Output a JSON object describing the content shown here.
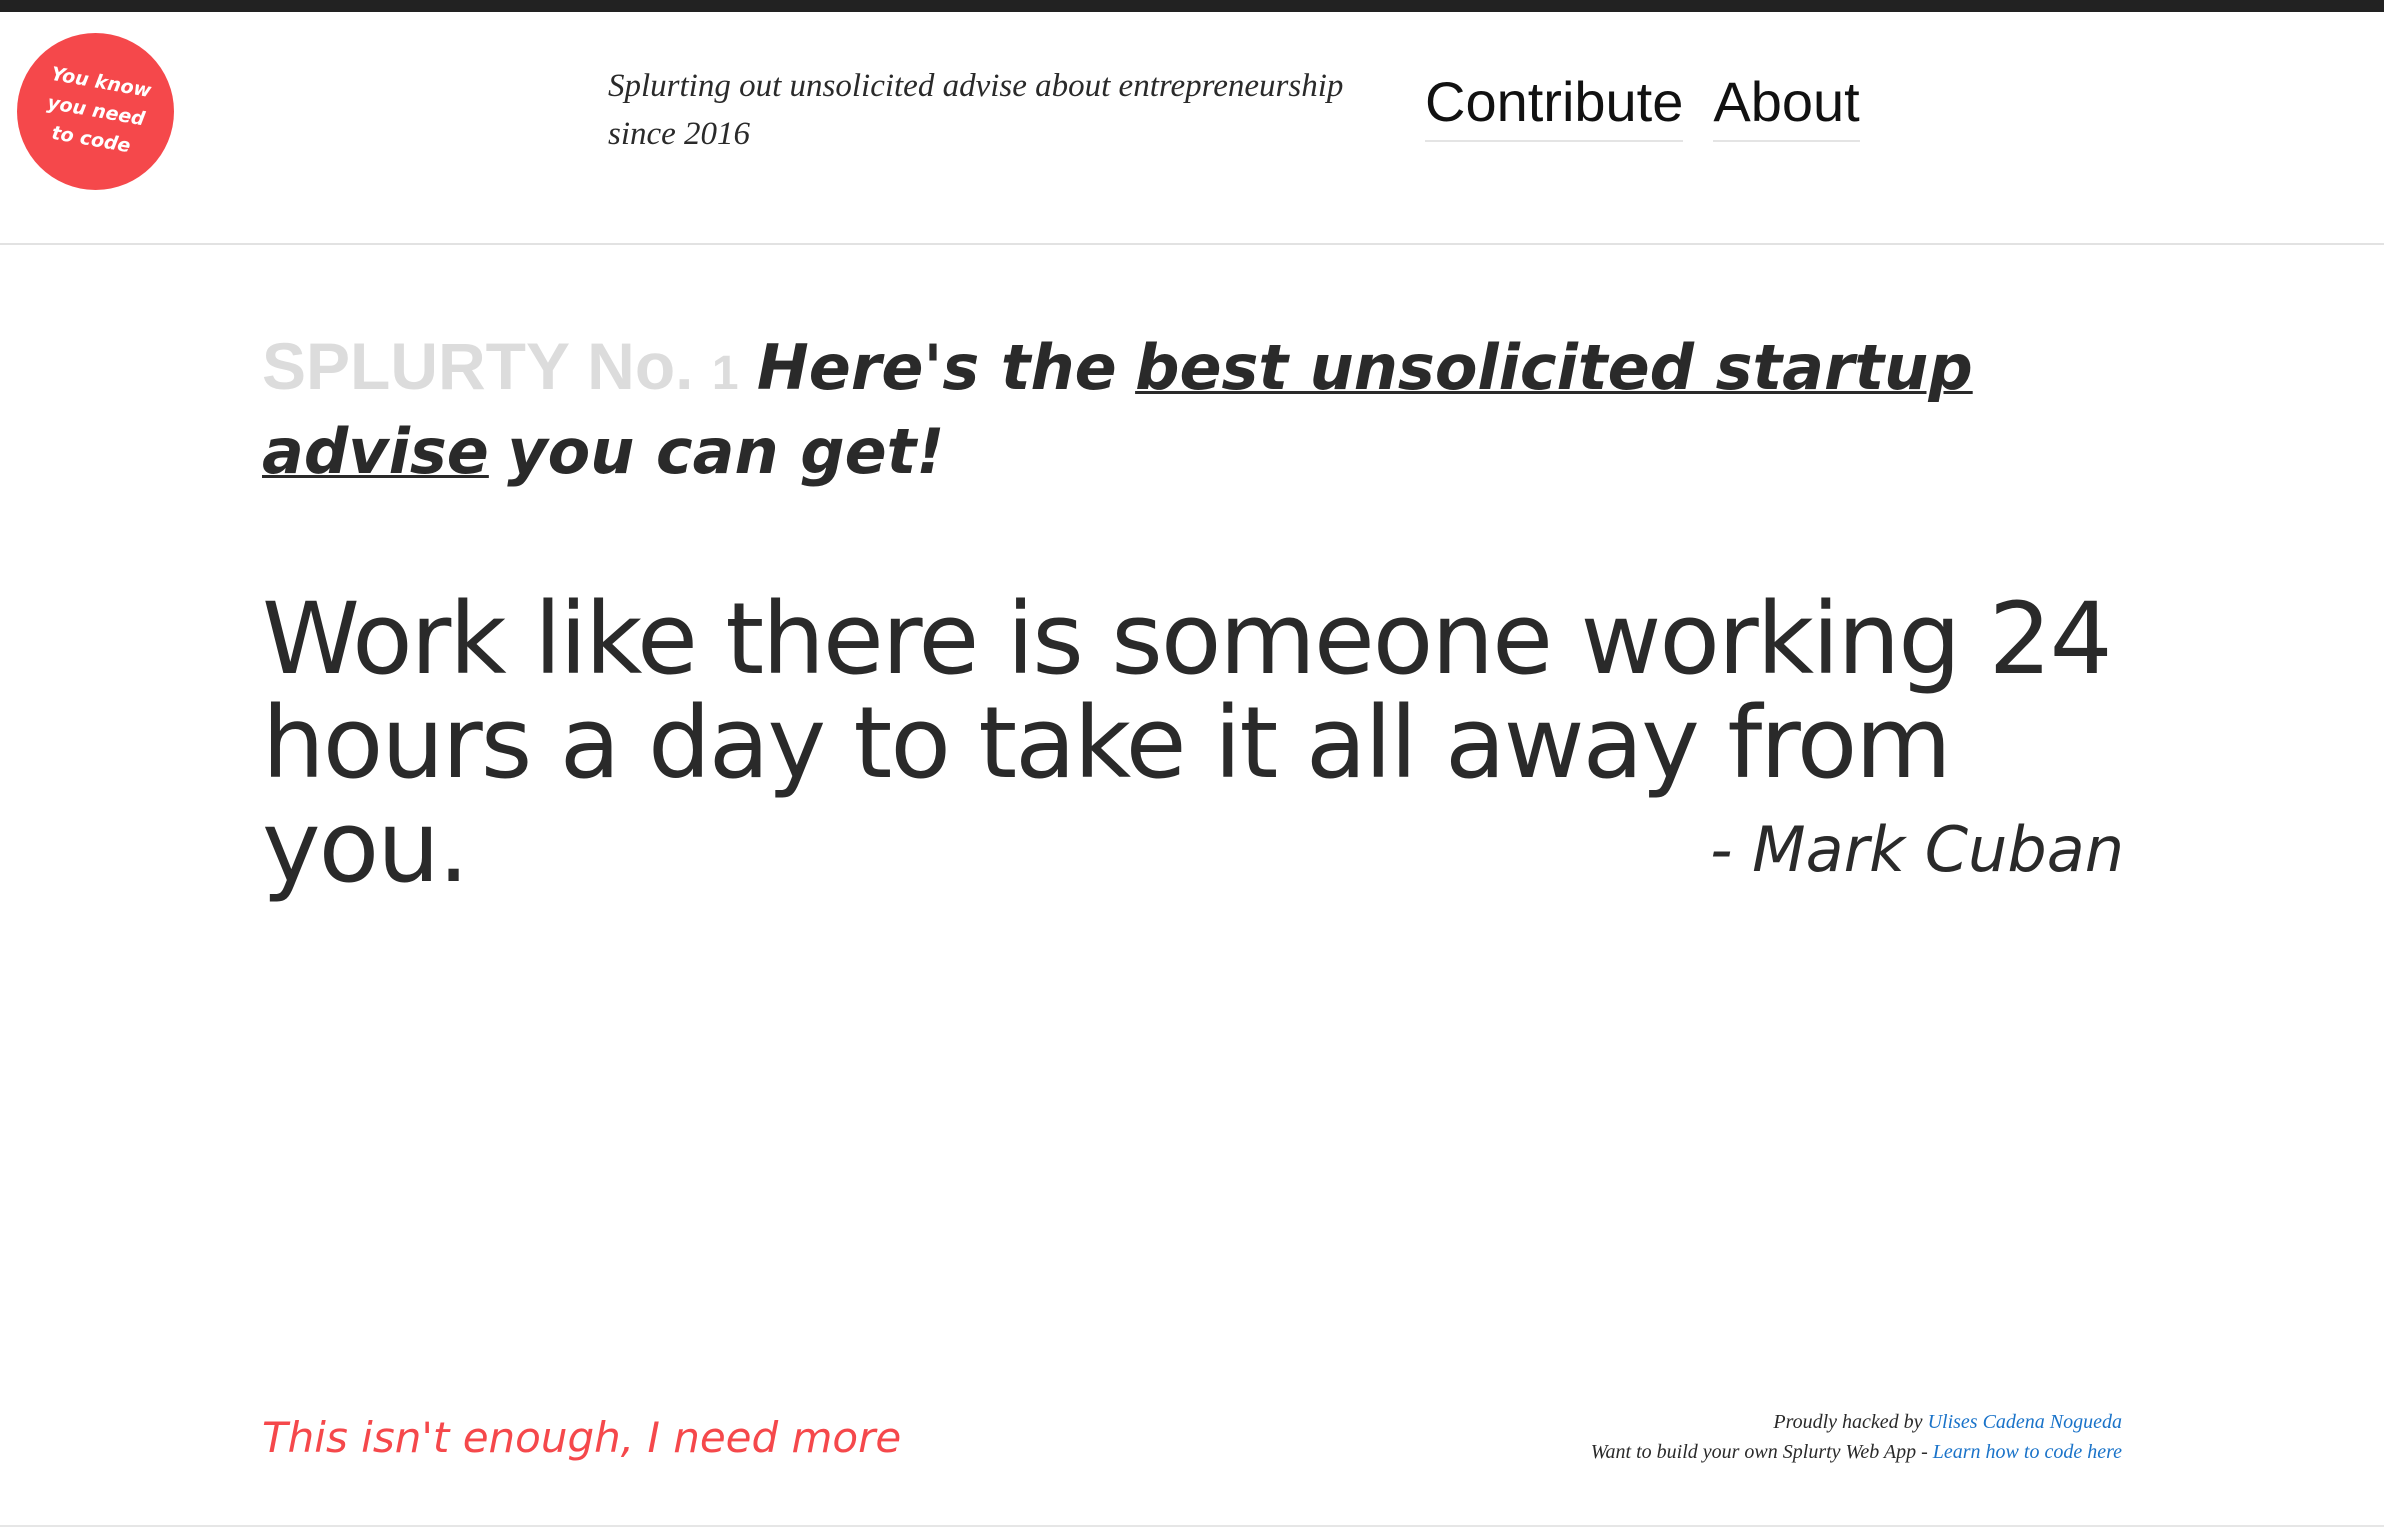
{
  "badge": {
    "text": "You know you need to code",
    "color": "#f5484b"
  },
  "header": {
    "tagline": "Splurting out unsolicited advise about entrepreneurship since 2016",
    "nav": {
      "contribute": "Contribute",
      "about": "About"
    }
  },
  "main": {
    "splurty_label": "SPLURTY No.",
    "splurty_number": "1",
    "headline_before": "Here's the",
    "headline_link": "best unsolicited startup advise",
    "headline_after": "you can get!",
    "quote": "Work like there is someone working 24 hours a day to take it all away from you.",
    "author": "- Mark Cuban"
  },
  "footer": {
    "more_link": "This isn't enough, I need more",
    "credit_prefix": "Proudly hacked by",
    "credit_name": "Ulises Cadena Nogueda",
    "build_prefix": "Want to build your own Splurty Web App -",
    "build_link": "Learn how to code here"
  },
  "colors": {
    "accent": "#f5484b",
    "link_blue": "#1a73c9",
    "text": "#2a2a2a",
    "muted": "#dcdcdc"
  }
}
